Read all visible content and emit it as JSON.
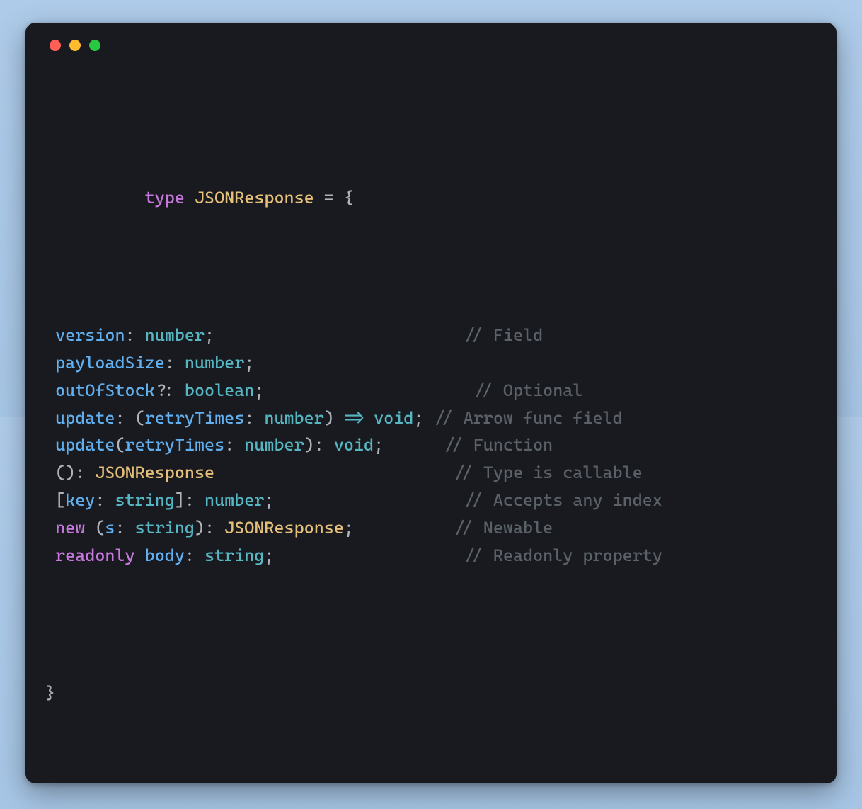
{
  "window": {
    "traffic_lights": [
      "close",
      "minimize",
      "zoom"
    ]
  },
  "colors": {
    "keyword": "#c678dd",
    "typeName": "#e5c07b",
    "property": "#61afef",
    "primitive": "#56b6c2",
    "punct": "#aeb2bb",
    "comment": "#5b6169",
    "background": "#191a1f"
  },
  "code": {
    "header": {
      "kw_type": "type",
      "name": "JSONResponse",
      "eq": " = ",
      "brace_open": "{"
    },
    "lines": [
      {
        "indent": " ",
        "tokens": [
          {
            "cls": "prop",
            "t": "version"
          },
          {
            "cls": "punct",
            "t": ": "
          },
          {
            "cls": "t-type",
            "t": "number"
          },
          {
            "cls": "punct",
            "t": ";"
          }
        ],
        "pad": "                         ",
        "comment_slashes": "// ",
        "comment": "Field"
      },
      {
        "indent": " ",
        "tokens": [
          {
            "cls": "prop",
            "t": "payloadSize"
          },
          {
            "cls": "punct",
            "t": ": "
          },
          {
            "cls": "t-type",
            "t": "number"
          },
          {
            "cls": "punct",
            "t": ";"
          }
        ],
        "pad": "",
        "comment_slashes": "",
        "comment": ""
      },
      {
        "indent": " ",
        "tokens": [
          {
            "cls": "prop",
            "t": "outOfStock"
          },
          {
            "cls": "punct",
            "t": "?: "
          },
          {
            "cls": "t-type",
            "t": "boolean"
          },
          {
            "cls": "punct",
            "t": ";"
          }
        ],
        "pad": "                     ",
        "comment_slashes": "// ",
        "comment": "Optional"
      },
      {
        "indent": " ",
        "tokens": [
          {
            "cls": "prop",
            "t": "update"
          },
          {
            "cls": "punct",
            "t": ": ("
          },
          {
            "cls": "prop",
            "t": "retryTimes"
          },
          {
            "cls": "punct",
            "t": ": "
          },
          {
            "cls": "t-type",
            "t": "number"
          },
          {
            "cls": "punct",
            "t": ") "
          },
          {
            "cls": "op",
            "t": "=>"
          },
          {
            "cls": "punct",
            "t": " "
          },
          {
            "cls": "t-type",
            "t": "void"
          },
          {
            "cls": "punct",
            "t": ";"
          }
        ],
        "pad": " ",
        "comment_slashes": "// ",
        "comment": "Arrow func field"
      },
      {
        "indent": " ",
        "tokens": [
          {
            "cls": "prop",
            "t": "update"
          },
          {
            "cls": "punct",
            "t": "("
          },
          {
            "cls": "prop",
            "t": "retryTimes"
          },
          {
            "cls": "punct",
            "t": ": "
          },
          {
            "cls": "t-type",
            "t": "number"
          },
          {
            "cls": "punct",
            "t": "): "
          },
          {
            "cls": "t-type",
            "t": "void"
          },
          {
            "cls": "punct",
            "t": ";"
          }
        ],
        "pad": "      ",
        "comment_slashes": "// ",
        "comment": "Function"
      },
      {
        "indent": " ",
        "tokens": [
          {
            "cls": "punct",
            "t": "(): "
          },
          {
            "cls": "typename",
            "t": "JSONResponse"
          }
        ],
        "pad": "                        ",
        "comment_slashes": "// ",
        "comment": "Type is callable"
      },
      {
        "indent": " ",
        "tokens": [
          {
            "cls": "punct",
            "t": "["
          },
          {
            "cls": "prop",
            "t": "key"
          },
          {
            "cls": "punct",
            "t": ": "
          },
          {
            "cls": "t-type",
            "t": "string"
          },
          {
            "cls": "punct",
            "t": "]: "
          },
          {
            "cls": "t-type",
            "t": "number"
          },
          {
            "cls": "punct",
            "t": ";"
          }
        ],
        "pad": "                   ",
        "comment_slashes": "// ",
        "comment": "Accepts any index"
      },
      {
        "indent": " ",
        "tokens": [
          {
            "cls": "kw",
            "t": "new"
          },
          {
            "cls": "punct",
            "t": " ("
          },
          {
            "cls": "prop",
            "t": "s"
          },
          {
            "cls": "punct",
            "t": ": "
          },
          {
            "cls": "t-type",
            "t": "string"
          },
          {
            "cls": "punct",
            "t": "): "
          },
          {
            "cls": "typename",
            "t": "JSONResponse"
          },
          {
            "cls": "punct",
            "t": ";"
          }
        ],
        "pad": "          ",
        "comment_slashes": "// ",
        "comment": "Newable"
      },
      {
        "indent": " ",
        "tokens": [
          {
            "cls": "kw",
            "t": "readonly"
          },
          {
            "cls": "punct",
            "t": " "
          },
          {
            "cls": "prop",
            "t": "body"
          },
          {
            "cls": "punct",
            "t": ": "
          },
          {
            "cls": "t-type",
            "t": "string"
          },
          {
            "cls": "punct",
            "t": ";"
          }
        ],
        "pad": "                   ",
        "comment_slashes": "// ",
        "comment": "Readonly property"
      }
    ],
    "brace_close": "}"
  }
}
